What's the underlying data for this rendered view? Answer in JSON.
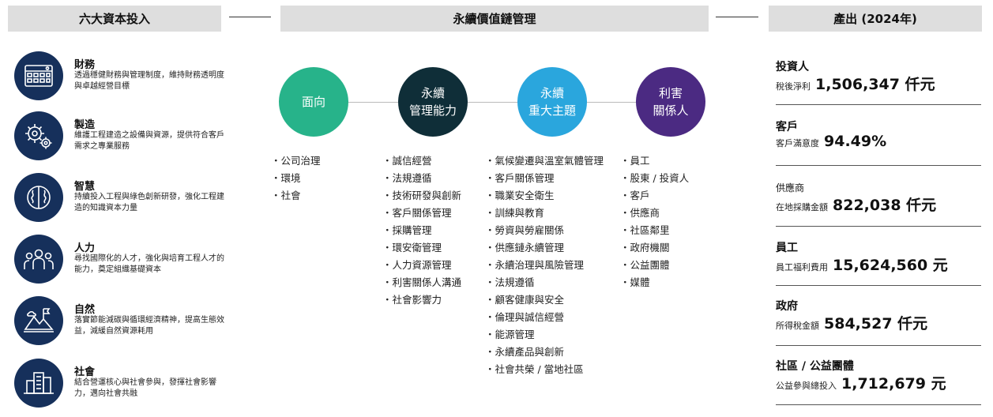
{
  "headers": {
    "inputs": "六大資本投入",
    "value_chain": "永續價值鏈管理",
    "outputs": "產出 (2024年)"
  },
  "capitals": [
    {
      "title": "財務",
      "desc": "透過穩健財務與管理制度，維持財務透明度與卓越經營目標",
      "icon": "calculator-icon"
    },
    {
      "title": "製造",
      "desc": "維護工程建造之設備與資源，提供符合客戶需求之專業服務",
      "icon": "gears-icon"
    },
    {
      "title": "智慧",
      "desc": "持續投入工程與綠色創新研發，強化工程建造的知識資本力量",
      "icon": "brain-icon"
    },
    {
      "title": "人力",
      "desc": "尋找國際化的人才，強化與培育工程人才的能力，奠定組織基礎資本",
      "icon": "people-icon"
    },
    {
      "title": "自然",
      "desc": "落實節能減碳與循環經濟精神，提高生態效益，減緩自然資源耗用",
      "icon": "mountain-icon"
    },
    {
      "title": "社會",
      "desc": "結合營運核心與社會參與，發揮社會影響力，邁向社會共融",
      "icon": "buildings-icon"
    }
  ],
  "circles": [
    {
      "line1": "面向",
      "line2": "",
      "color": "#27b38a"
    },
    {
      "line1": "永續",
      "line2": "管理能力",
      "color": "#0f2e38"
    },
    {
      "line1": "永續",
      "line2": "重大主題",
      "color": "#2aa6dd"
    },
    {
      "line1": "利害",
      "line2": "關係人",
      "color": "#4b2a82"
    }
  ],
  "lists": {
    "aspects": [
      "公司治理",
      "環境",
      "社會"
    ],
    "capabilities": [
      "誠信經營",
      "法規遵循",
      "技術研發與創新",
      "客戶關係管理",
      "採購管理",
      "環安衛管理",
      "人力資源管理",
      "利害關係人溝通",
      "社會影響力"
    ],
    "topics": [
      "氣候變遷與溫室氣體管理",
      "客戶關係管理",
      "職業安全衛生",
      "訓練與教育",
      "勞資與勞雇關係",
      "供應鏈永續管理",
      "永續治理與風險管理",
      "法規遵循",
      "顧客健康與安全",
      "倫理與誠信經營",
      "能源管理",
      "永續產品與創新",
      "社會共榮 / 當地社區"
    ],
    "stakeholders": [
      "員工",
      "股東 / 投資人",
      "客戶",
      "供應商",
      "社區鄰里",
      "政府機關",
      "公益團體",
      "媒體"
    ]
  },
  "outputs": [
    {
      "name": "投資人",
      "label": "稅後淨利",
      "value": "1,506,347 仟元",
      "name_small": false
    },
    {
      "name": "客戶",
      "label": "客戶滿意度",
      "value": "94.49%",
      "name_small": false
    },
    {
      "name": "供應商",
      "label": "在地採購金額",
      "value": "822,038 仟元",
      "name_small": true
    },
    {
      "name": "員工",
      "label": "員工福利費用",
      "value": "15,624,560 元",
      "name_small": false
    },
    {
      "name": "政府",
      "label": "所得稅金額",
      "value": "584,527 仟元",
      "name_small": false
    },
    {
      "name": "社區 / 公益團體",
      "label": "公益參與總投入",
      "value": "1,712,679 元",
      "name_small": false
    }
  ]
}
